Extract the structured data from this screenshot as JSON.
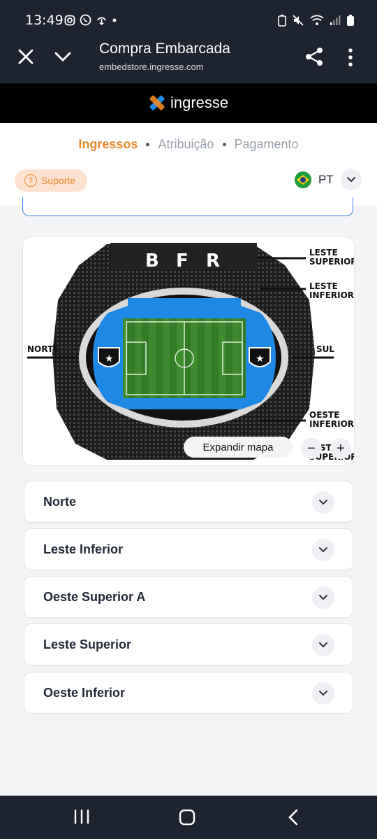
{
  "status_bar": {
    "time": "13:49",
    "icons": [
      "instagram-icon",
      "whatsapp-icon",
      "download-icon",
      "battery-saver-icon",
      "mute-icon",
      "wifi-icon",
      "signal-icon",
      "battery-icon"
    ]
  },
  "browser": {
    "title": "Compra Embarcada",
    "url": "embedstore.ingresse.com"
  },
  "brand": {
    "name": "ingresse"
  },
  "steps": {
    "items": [
      "Ingressos",
      "Atribuição",
      "Pagamento"
    ],
    "active_index": 0
  },
  "support": {
    "label": "Suporte"
  },
  "language": {
    "code": "PT"
  },
  "map": {
    "labels": {
      "leste_superior_1": "LESTE",
      "leste_superior_2": "SUPERIOR",
      "leste_inferior_1": "LESTE",
      "leste_inferior_2": "INFERIOR",
      "norte": "NORTE",
      "sul": "SUL",
      "oeste_inferior_1": "OESTE",
      "oeste_inferior_2": "INFERIOR",
      "oeste_superior_1": "ST",
      "oeste_superior_2": "SUPERIOR",
      "letters": [
        "B",
        "F",
        "R"
      ]
    },
    "expand_label": "Expandir mapa",
    "zoom_out_label": "−",
    "zoom_in_label": "+"
  },
  "sectors": [
    {
      "name": "Norte"
    },
    {
      "name": "Leste Inferior"
    },
    {
      "name": "Oeste Superior A"
    },
    {
      "name": "Leste Superior"
    },
    {
      "name": "Oeste Inferior"
    }
  ],
  "colors": {
    "accent": "#e98a2c",
    "field_blue": "#1e88e5",
    "pitch_green": "#3f8a2f",
    "header": "#1d2430"
  }
}
